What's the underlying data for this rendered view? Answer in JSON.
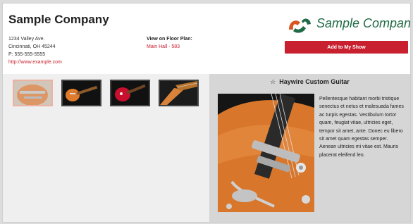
{
  "company": {
    "name": "Sample Company",
    "address_line1": "1234 Valley Ave.",
    "address_line2": "Cincinnati, OH 45244",
    "phone": "P: 555-555-5555",
    "website": "http://www.example.com"
  },
  "floor_plan": {
    "label": "View on Floor Plan:",
    "location": "Main Hall - 583"
  },
  "logo": {
    "text": "Sample Company",
    "icon": "sample-company-logo-icon"
  },
  "actions": {
    "add_label": "Add to My Show"
  },
  "gallery": {
    "thumbnails": [
      {
        "alt": "guitar-body-orange-thumbnail",
        "selected": true
      },
      {
        "alt": "guitar-full-orange-thumbnail",
        "selected": false
      },
      {
        "alt": "guitar-red-thumbnail",
        "selected": false
      },
      {
        "alt": "guitar-neck-closeup-thumbnail",
        "selected": false
      }
    ]
  },
  "product": {
    "title": "Haywire Custom Guitar",
    "description": "Pellentesque habitant morbi tristique senectus et netus et malesuada fames ac turpis egestas. Vestibulum tortor quam, feugiat vitae, ultricies eget, tempor sit amet, ante. Donec eu libero sit amet quam egestas semper. Aenean ultricies mi vitae est. Mauris placerat eleifend leo."
  },
  "colors": {
    "accent": "#c8202e",
    "brand_green": "#1f6b45",
    "brand_orange": "#d9561e"
  }
}
